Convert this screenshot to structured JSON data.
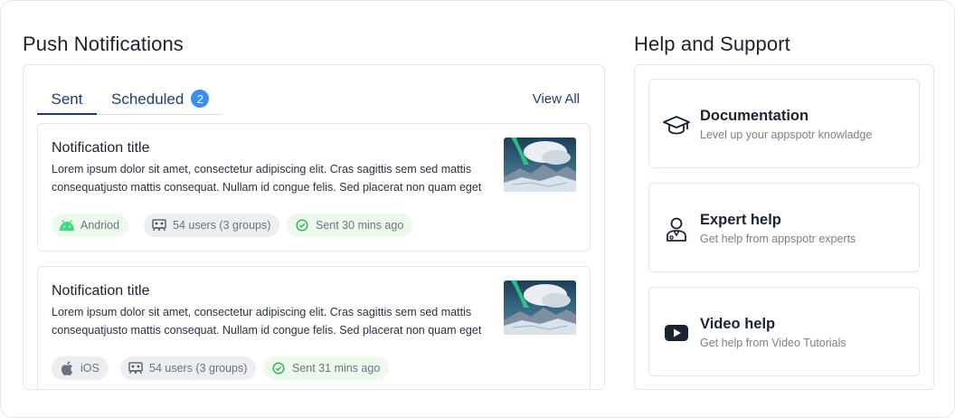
{
  "push": {
    "title": "Push Notifications",
    "tabs": [
      {
        "label": "Sent",
        "active": true
      },
      {
        "label": "Scheduled",
        "badge": "2"
      }
    ],
    "view_all": "View All",
    "notifications": [
      {
        "title": "Notification title",
        "body_line1": "Lorem ipsum dolor sit amet, consectetur adipiscing elit. Cras sagittis sem sed mattis",
        "body_line2": "consequatjusto mattis consequat. Nullam id congue felis. Sed placerat non quam eget",
        "platform": "Andriod",
        "platform_icon": "android-icon",
        "users": "54 users (3 groups)",
        "users_icon": "users-icon",
        "sent": "Sent 30 mins ago",
        "sent_icon": "check-circle-icon"
      },
      {
        "title": "Notification title",
        "body_line1": "Lorem ipsum dolor sit amet, consectetur adipiscing elit. Cras sagittis sem sed mattis",
        "body_line2": "consequatjusto mattis consequat. Nullam id congue felis. Sed placerat non quam eget",
        "platform": "iOS",
        "platform_icon": "apple-icon",
        "users": "54 users (3 groups)",
        "users_icon": "users-icon",
        "sent": "Sent 31 mins ago",
        "sent_icon": "check-circle-icon"
      }
    ]
  },
  "help": {
    "title": "Help and Support",
    "items": [
      {
        "title": "Documentation",
        "subtitle": "Level up your appspotr knowladge",
        "icon": "graduation-cap-icon"
      },
      {
        "title": "Expert help",
        "subtitle": "Get help from appspotr experts",
        "icon": "user-icon"
      },
      {
        "title": "Video help",
        "subtitle": "Get help from Video Tutorials",
        "icon": "youtube-icon"
      }
    ]
  },
  "colors": {
    "accent": "#1f3f73",
    "badge": "#3b8ef0",
    "android_green": "#3ddc84",
    "sent_green": "#2bb24c",
    "chip_green_bg": "#eef9ee",
    "chip_gray_bg": "#eceef1"
  }
}
